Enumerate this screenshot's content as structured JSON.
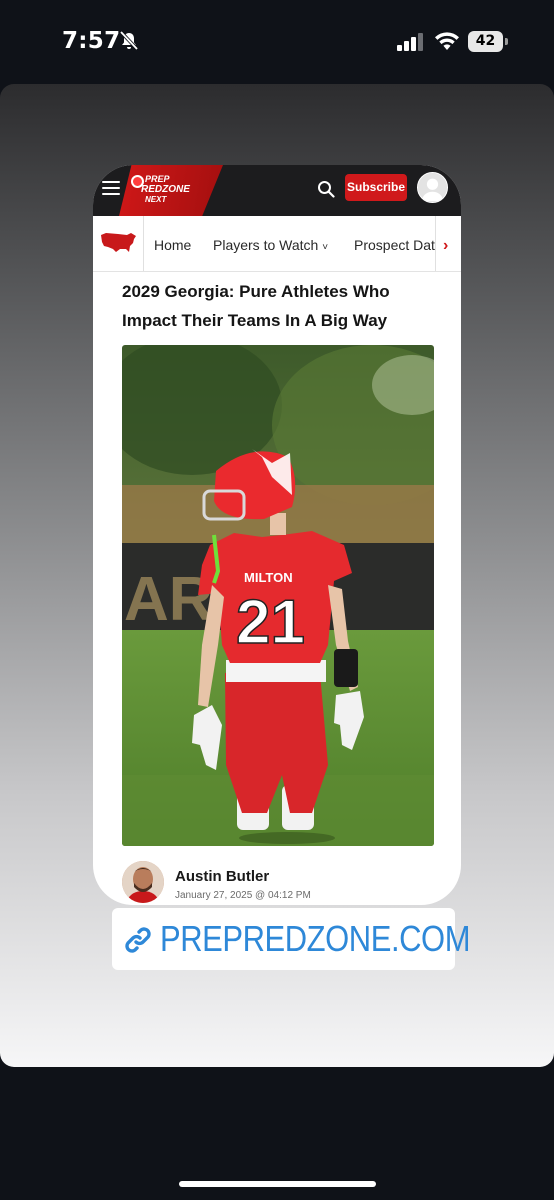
{
  "status_bar": {
    "time": "7:57",
    "battery_level": "42",
    "icons": [
      "bell-slash-icon",
      "signal-icon",
      "wifi-icon",
      "battery-icon"
    ]
  },
  "site": {
    "logo": {
      "line1": "PREP",
      "line2": "REDZONE",
      "line3": "NEXT"
    },
    "subscribe_label": "Subscribe",
    "nav_items": [
      "Home",
      "Players to Watch",
      "Prospect Dat"
    ],
    "accent_color": "#d0191b"
  },
  "article": {
    "title": "2029 Georgia: Pure Athletes Who Impact Their Teams In A Big Way",
    "jersey_text": "MILTON",
    "jersey_number": "21",
    "author": "Austin Butler",
    "date": "January 27, 2025 @ 04:12 PM"
  },
  "sticker": {
    "link_text": "PREPREDZONE.COM",
    "link_color": "#2e88d8"
  }
}
